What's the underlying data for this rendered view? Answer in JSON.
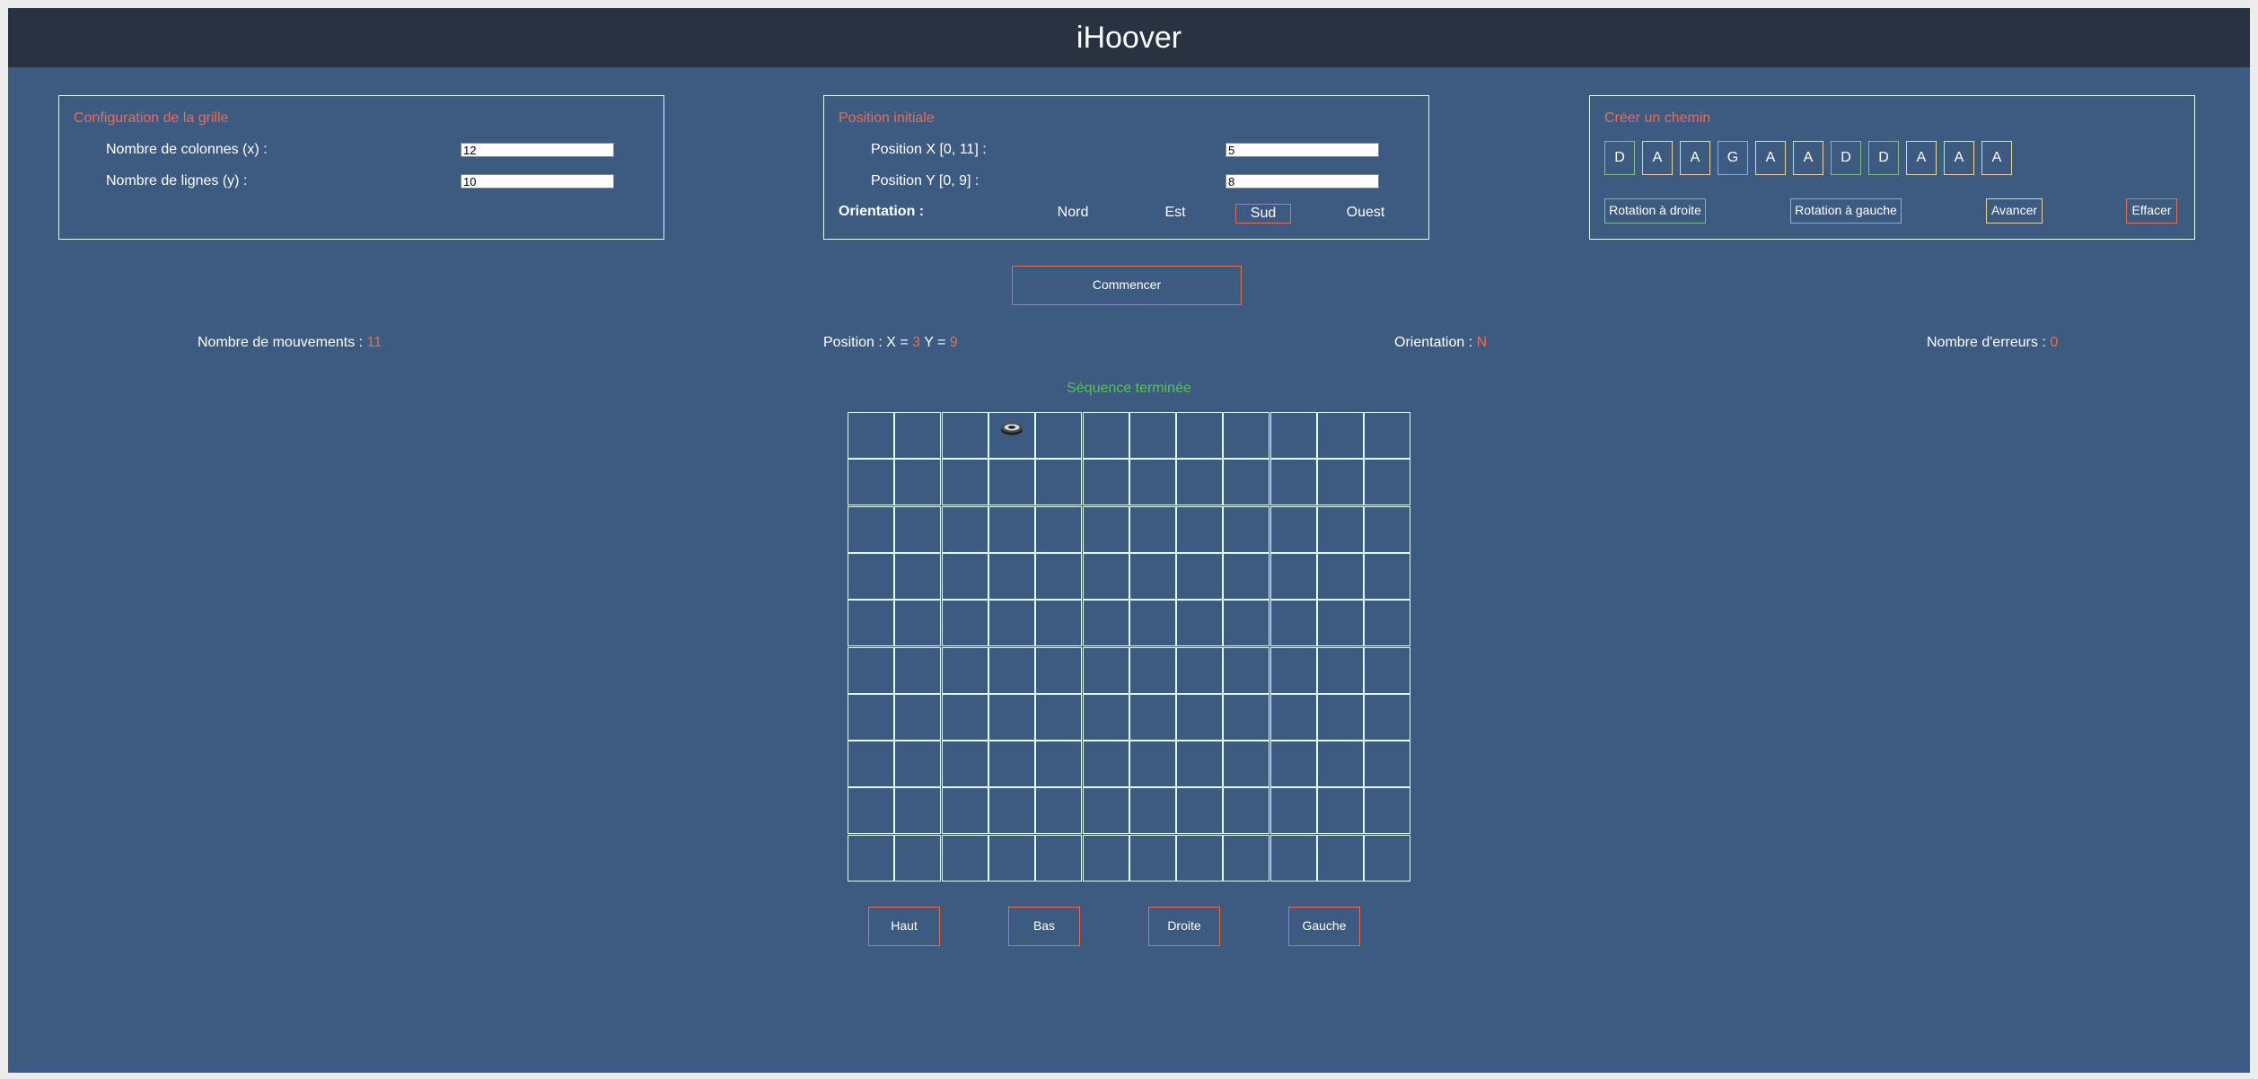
{
  "app": {
    "title": "iHoover"
  },
  "grid_config": {
    "title": "Configuration de la grille",
    "columns_label": "Nombre de colonnes (x) :",
    "columns_value": "12",
    "rows_label": "Nombre de lignes (y) :",
    "rows_value": "10"
  },
  "initial_position": {
    "title": "Position initiale",
    "x_label": "Position X [0, 11] :",
    "x_value": "5",
    "y_label": "Position Y [0, 9] :",
    "y_value": "8",
    "orientation_label": "Orientation :",
    "orientations": [
      "Nord",
      "Est",
      "Sud",
      "Ouest"
    ],
    "selected_orientation": "Sud"
  },
  "path": {
    "title": "Créer un chemin",
    "commands": [
      "D",
      "A",
      "A",
      "G",
      "A",
      "A",
      "D",
      "D",
      "A",
      "A",
      "A"
    ],
    "buttons": {
      "rotate_right": "Rotation à droite",
      "rotate_left": "Rotation à gauche",
      "forward": "Avancer",
      "clear": "Effacer"
    }
  },
  "start_button": "Commencer",
  "stats": {
    "moves_label": "Nombre de mouvements : ",
    "moves_value": "11",
    "position_prefix": "Position : X = ",
    "position_x": "3",
    "position_mid": " Y = ",
    "position_y": "9",
    "orientation_label": "Orientation : ",
    "orientation_value": "N",
    "errors_label": "Nombre d'erreurs : ",
    "errors_value": "0"
  },
  "status_message": "Séquence terminée",
  "board": {
    "columns": 12,
    "rows": 10,
    "robot_col": 3,
    "robot_row_from_top": 0,
    "robot_icon": "robot-vacuum-icon"
  },
  "direction_buttons": {
    "up": "Haut",
    "down": "Bas",
    "right": "Droite",
    "left": "Gauche"
  },
  "colors": {
    "background": "#3d5a80",
    "header": "#293241",
    "accent": "#ee6c4d",
    "border": "#e0fbfc",
    "success": "#57c25c",
    "chip_D": "#7dc07f",
    "chip_A": "#e7d49b",
    "chip_G": "#87b0d9"
  }
}
